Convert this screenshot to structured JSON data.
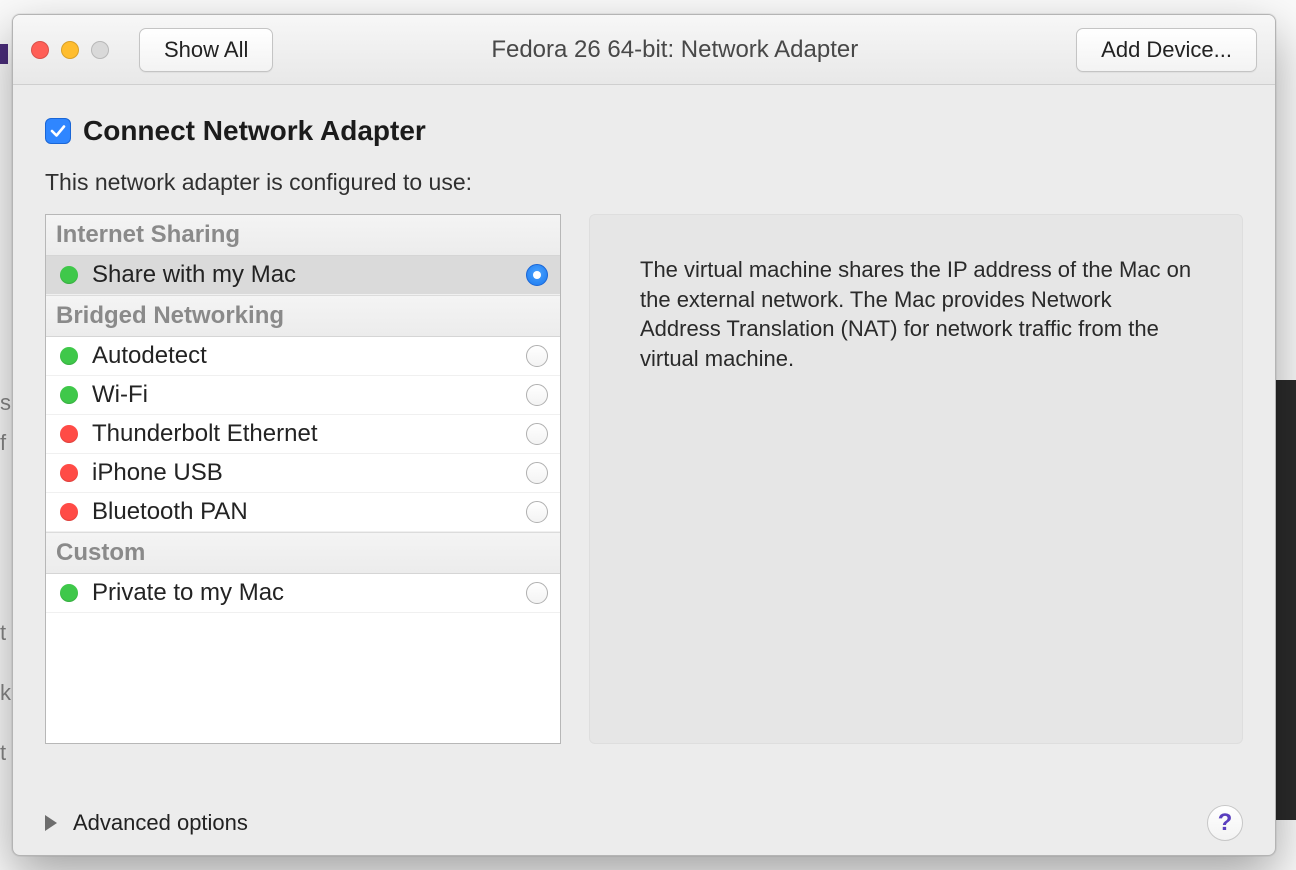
{
  "titlebar": {
    "show_all_label": "Show All",
    "title": "Fedora 26 64-bit: Network Adapter",
    "add_device_label": "Add Device..."
  },
  "checkbox": {
    "checked": true,
    "label": "Connect Network Adapter"
  },
  "subtext": "This network adapter is configured to use:",
  "groups": [
    {
      "title": "Internet Sharing",
      "items": [
        {
          "label": "Share with my Mac",
          "status": "green",
          "selected": true
        }
      ]
    },
    {
      "title": "Bridged Networking",
      "items": [
        {
          "label": "Autodetect",
          "status": "green",
          "selected": false
        },
        {
          "label": "Wi-Fi",
          "status": "green",
          "selected": false
        },
        {
          "label": "Thunderbolt Ethernet",
          "status": "red",
          "selected": false
        },
        {
          "label": "iPhone USB",
          "status": "red",
          "selected": false
        },
        {
          "label": "Bluetooth PAN",
          "status": "red",
          "selected": false
        }
      ]
    },
    {
      "title": "Custom",
      "items": [
        {
          "label": "Private to my Mac",
          "status": "green",
          "selected": false
        }
      ]
    }
  ],
  "description": "The virtual machine shares the IP address of the Mac on the external network. The Mac provides Network Address Translation (NAT) for network traffic from the virtual machine.",
  "footer": {
    "advanced_label": "Advanced options",
    "help_label": "?"
  },
  "backdrop": {
    "t1": "s",
    "t2": "f",
    "t3": "t",
    "t4": "k",
    "t5": "t"
  }
}
